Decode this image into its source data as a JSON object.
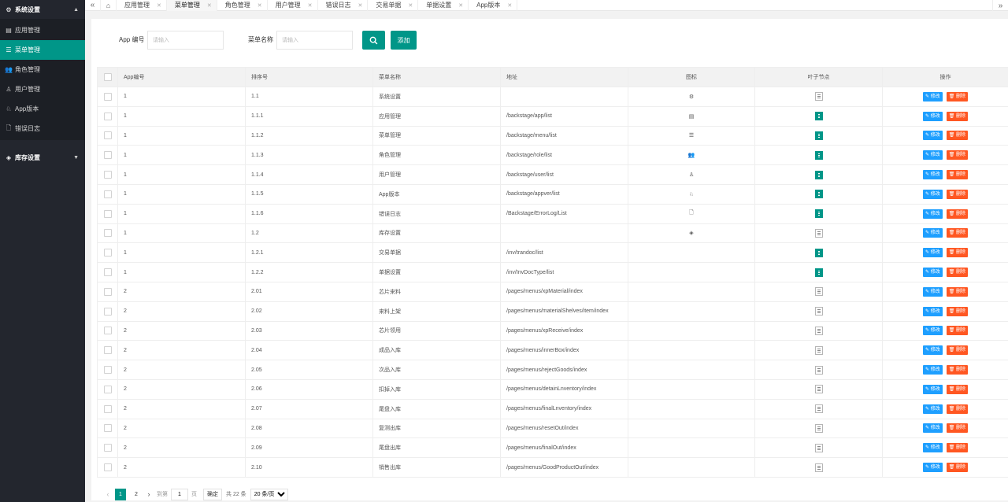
{
  "sidebar": {
    "groups": [
      {
        "label": "系统设置",
        "icon": "gear-icon",
        "expanded": true,
        "items": [
          {
            "label": "应用管理",
            "icon": "app-icon",
            "active": false
          },
          {
            "label": "菜单管理",
            "icon": "list-icon",
            "active": true
          },
          {
            "label": "角色管理",
            "icon": "users-icon",
            "active": false
          },
          {
            "label": "用户管理",
            "icon": "user-icon",
            "active": false
          },
          {
            "label": "App版本",
            "icon": "android-icon",
            "active": false
          },
          {
            "label": "错误日志",
            "icon": "file-icon",
            "active": false
          }
        ]
      },
      {
        "label": "库存设置",
        "icon": "layers-icon",
        "expanded": false
      }
    ]
  },
  "tabs": [
    {
      "label": "应用管理",
      "active": false
    },
    {
      "label": "菜单管理",
      "active": true
    },
    {
      "label": "角色管理",
      "active": false
    },
    {
      "label": "用户管理",
      "active": false
    },
    {
      "label": "错误日志",
      "active": false
    },
    {
      "label": "交易单据",
      "active": false
    },
    {
      "label": "单据设置",
      "active": false
    },
    {
      "label": "App版本",
      "active": false
    }
  ],
  "search": {
    "app_label": "App 编号",
    "app_placeholder": "请输入",
    "menu_label": "菜单名称",
    "menu_placeholder": "请输入",
    "add_label": "添加"
  },
  "table": {
    "columns": [
      "App编号",
      "排序号",
      "菜单名称",
      "地址",
      "图标",
      "叶子节点",
      "操作"
    ],
    "edit_label": "修改",
    "delete_label": "删除",
    "rows": [
      {
        "app": "1",
        "sort": "1.1",
        "name": "系统设置",
        "url": "",
        "icon": "gear-icon",
        "leaf": false
      },
      {
        "app": "1",
        "sort": "1.1.1",
        "name": "应用管理",
        "url": "/backstage/app/list",
        "icon": "app-icon",
        "leaf": true
      },
      {
        "app": "1",
        "sort": "1.1.2",
        "name": "菜单管理",
        "url": "/backstage/menu/list",
        "icon": "list-icon",
        "leaf": true
      },
      {
        "app": "1",
        "sort": "1.1.3",
        "name": "角色管理",
        "url": "/backstage/role/list",
        "icon": "users-icon",
        "leaf": true
      },
      {
        "app": "1",
        "sort": "1.1.4",
        "name": "用户管理",
        "url": "/backstage/user/list",
        "icon": "user-icon",
        "leaf": true
      },
      {
        "app": "1",
        "sort": "1.1.5",
        "name": "App版本",
        "url": "/backstage/appver/list",
        "icon": "android-icon",
        "leaf": true
      },
      {
        "app": "1",
        "sort": "1.1.6",
        "name": "错误日志",
        "url": "/Backstage/ErrorLog/List",
        "icon": "file-icon",
        "leaf": true
      },
      {
        "app": "1",
        "sort": "1.2",
        "name": "库存设置",
        "url": "",
        "icon": "layers-icon",
        "leaf": false
      },
      {
        "app": "1",
        "sort": "1.2.1",
        "name": "交易单据",
        "url": "/inv/trandoc/list",
        "icon": "",
        "leaf": true
      },
      {
        "app": "1",
        "sort": "1.2.2",
        "name": "单据设置",
        "url": "/inv/InvDocType/list",
        "icon": "",
        "leaf": true
      },
      {
        "app": "2",
        "sort": "2.01",
        "name": "芯片来料",
        "url": "/pages/menus/xpMaterial/index",
        "icon": "",
        "leaf": false
      },
      {
        "app": "2",
        "sort": "2.02",
        "name": "来料上架",
        "url": "/pages/menus/materialShelves/item/index",
        "icon": "",
        "leaf": false
      },
      {
        "app": "2",
        "sort": "2.03",
        "name": "芯片领用",
        "url": "/pages/menus/xpReceive/index",
        "icon": "",
        "leaf": false
      },
      {
        "app": "2",
        "sort": "2.04",
        "name": "成品入库",
        "url": "/pages/menus/innerBox/index",
        "icon": "",
        "leaf": false
      },
      {
        "app": "2",
        "sort": "2.05",
        "name": "次品入库",
        "url": "/pages/menus/rejectGoods/index",
        "icon": "",
        "leaf": false
      },
      {
        "app": "2",
        "sort": "2.06",
        "name": "扣掉入库",
        "url": "/pages/menus/detainLnventory/index",
        "icon": "",
        "leaf": false
      },
      {
        "app": "2",
        "sort": "2.07",
        "name": "尾盘入库",
        "url": "/pages/menus/finalLnventory/index",
        "icon": "",
        "leaf": false
      },
      {
        "app": "2",
        "sort": "2.08",
        "name": "复测出库",
        "url": "/pages/menus/resetOut/index",
        "icon": "",
        "leaf": false
      },
      {
        "app": "2",
        "sort": "2.09",
        "name": "尾盘出库",
        "url": "/pages/menus/finalOut/index",
        "icon": "",
        "leaf": false
      },
      {
        "app": "2",
        "sort": "2.10",
        "name": "销售出库",
        "url": "/pages/menus/GoodProductOut/index",
        "icon": "",
        "leaf": false
      }
    ]
  },
  "pager": {
    "pages": [
      "1",
      "2"
    ],
    "current": "1",
    "goto_label": "到第",
    "goto_value": "1",
    "page_unit": "页",
    "confirm_label": "确定",
    "total_label": "共 22 条",
    "size_label": "20 条/页"
  },
  "colors": {
    "accent": "#009688",
    "sidebar_bg": "#23262e",
    "edit": "#1e9fff",
    "delete": "#ff5722"
  }
}
